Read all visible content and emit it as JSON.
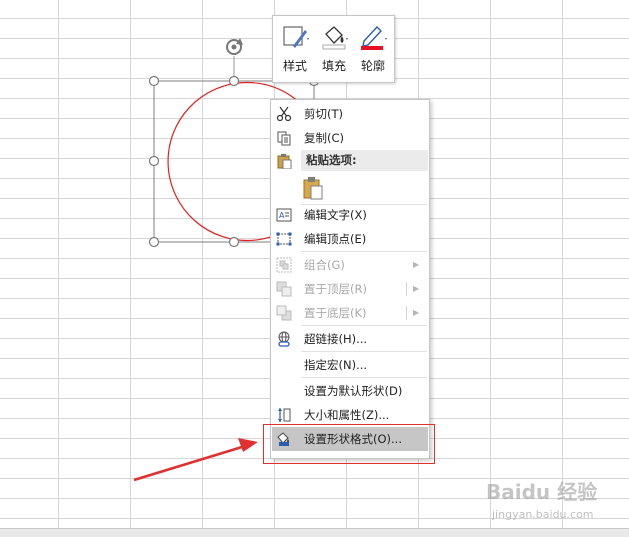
{
  "mini_toolbar": {
    "buttons": [
      {
        "label": "样式",
        "icon": "shape-style-icon"
      },
      {
        "label": "填充",
        "icon": "fill-bucket-icon"
      },
      {
        "label": "轮廓",
        "icon": "outline-pen-icon"
      }
    ]
  },
  "context_menu": {
    "items": [
      {
        "label": "剪切(T)",
        "icon": "scissors-icon",
        "enabled": true
      },
      {
        "label": "复制(C)",
        "icon": "copy-icon",
        "enabled": true
      },
      {
        "label": "粘贴选项:",
        "icon": "paste-icon",
        "header": true
      },
      {
        "label": "编辑文字(X)",
        "icon": "edit-text-icon",
        "enabled": true
      },
      {
        "label": "编辑顶点(E)",
        "icon": "edit-points-icon",
        "enabled": true
      },
      {
        "label": "组合(G)",
        "icon": "group-icon",
        "enabled": false,
        "submenu": true
      },
      {
        "label": "置于顶层(R)",
        "icon": "bring-to-front-icon",
        "enabled": false,
        "submenu": true
      },
      {
        "label": "置于底层(K)",
        "icon": "send-to-back-icon",
        "enabled": false,
        "submenu": true
      },
      {
        "label": "超链接(H)...",
        "icon": "hyperlink-icon",
        "enabled": true
      },
      {
        "label": "指定宏(N)...",
        "enabled": true
      },
      {
        "label": "设置为默认形状(D)",
        "enabled": true
      },
      {
        "label": "大小和属性(Z)...",
        "icon": "size-properties-icon",
        "enabled": true
      },
      {
        "label": "设置形状格式(O)...",
        "icon": "format-shape-icon",
        "enabled": true,
        "highlighted": true
      }
    ]
  },
  "watermark": {
    "text": "Baidu 经验",
    "url": "jingyan.baidu.com"
  },
  "colors": {
    "shape_outline": "#e02020",
    "annotation_red": "#e03030",
    "menu_highlight": "#c6c6c6"
  }
}
